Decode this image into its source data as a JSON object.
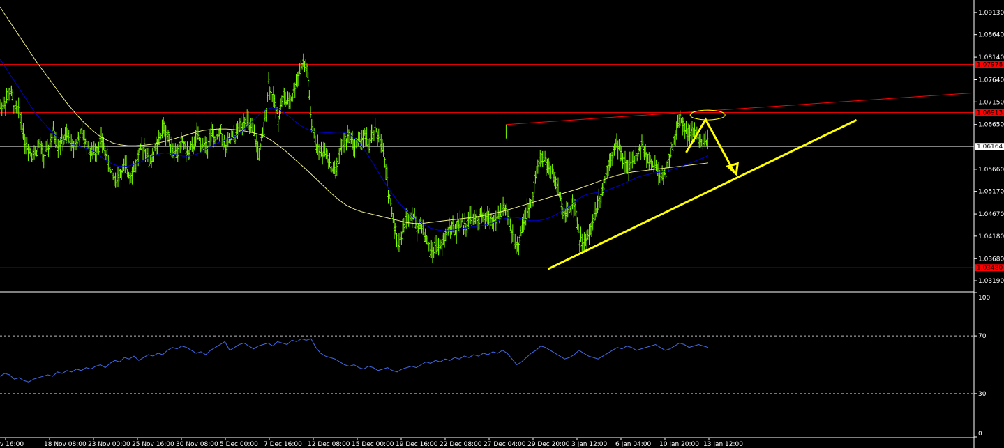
{
  "chart_data": [
    {
      "type": "candlestick",
      "panel": "main",
      "instrument_type": "bar-chart",
      "colors": {
        "background": "#000000",
        "bars": "#7CFC00",
        "axis_text": "#ffffff",
        "grid_line": "#ffffff",
        "support_resistance": "#ff0000",
        "annotation": "#ffff00",
        "fast_ma": "#0000cd",
        "slow_ma": "#eeee88"
      },
      "y_ticks": [
        "1.09130",
        "1.08640",
        "1.08140",
        "1.07640",
        "1.07150",
        "1.06650",
        "1.05660",
        "1.05170",
        "1.04670",
        "1.04180",
        "1.03680",
        "1.03190"
      ],
      "x_ticks": [
        "v 16:00",
        "18 Nov 08:00",
        "23 Nov 00:00",
        "25 Nov 16:00",
        "30 Nov 08:00",
        "5 Dec 00:00",
        "7 Dec 16:00",
        "12 Dec 08:00",
        "15 Dec 00:00",
        "19 Dec 16:00",
        "22 Dec 08:00",
        "27 Dec 04:00",
        "29 Dec 20:00",
        "3 Jan 12:00",
        "6 Jan 04:00",
        "10 Jan 20:00",
        "13 Jan 12:00"
      ],
      "ylim": [
        1.0299,
        1.0936
      ],
      "current_price": "1.06164",
      "horizontal_levels": [
        {
          "label": "1.07978",
          "value": 1.07978,
          "color": "#ff0000"
        },
        {
          "label": "1.06913",
          "value": 1.06913,
          "color": "#ff0000"
        },
        {
          "label": "1.03480",
          "value": 1.0348,
          "color": "#ff0000"
        }
      ],
      "price_path": [
        1.0705,
        1.0715,
        1.074,
        1.07,
        1.069,
        1.063,
        1.061,
        1.06,
        1.062,
        1.0595,
        1.061,
        1.065,
        1.062,
        1.063,
        1.064,
        1.0615,
        1.063,
        1.0645,
        1.062,
        1.06,
        1.061,
        1.063,
        1.0605,
        1.056,
        1.054,
        1.056,
        1.057,
        1.0555,
        1.057,
        1.06,
        1.062,
        1.058,
        1.06,
        1.0625,
        1.066,
        1.064,
        1.061,
        1.06,
        1.063,
        1.06,
        1.061,
        1.064,
        1.062,
        1.0615,
        1.0645,
        1.063,
        1.065,
        1.061,
        1.063,
        1.064,
        1.066,
        1.068,
        1.066,
        1.064,
        1.06,
        1.065,
        1.076,
        1.072,
        1.068,
        1.073,
        1.071,
        1.073,
        1.077,
        1.08,
        1.079,
        1.066,
        1.062,
        1.06,
        1.061,
        1.057,
        1.056,
        1.061,
        1.063,
        1.064,
        1.0615,
        1.063,
        1.064,
        1.062,
        1.065,
        1.064,
        1.06,
        1.052,
        1.046,
        1.04,
        1.043,
        1.046,
        1.047,
        1.044,
        1.044,
        1.041,
        1.038,
        1.04,
        1.039,
        1.042,
        1.044,
        1.043,
        1.045,
        1.044,
        1.046,
        1.045,
        1.046,
        1.0455,
        1.046,
        1.045,
        1.046,
        1.048,
        1.046,
        1.042,
        1.039,
        1.044,
        1.047,
        1.05,
        1.056,
        1.06,
        1.058,
        1.056,
        1.054,
        1.05,
        1.047,
        1.048,
        1.049,
        1.041,
        1.04,
        1.042,
        1.046,
        1.05,
        1.053,
        1.058,
        1.061,
        1.062,
        1.059,
        1.057,
        1.058,
        1.06,
        1.062,
        1.059,
        1.058,
        1.057,
        1.055,
        1.056,
        1.06,
        1.064,
        1.068,
        1.066,
        1.064,
        1.065,
        1.063,
        1.062,
        1.063
      ],
      "fast_ma": [
        1.081,
        1.079,
        1.077,
        1.075,
        1.073,
        1.071,
        1.069,
        1.0675,
        1.066,
        1.0645,
        1.0635,
        1.0628,
        1.0622,
        1.0618,
        1.0614,
        1.061,
        1.0605,
        1.0595,
        1.0585,
        1.0578,
        1.0573,
        1.0572,
        1.0574,
        1.0578,
        1.0583,
        1.059,
        1.0596,
        1.06,
        1.0602,
        1.06,
        1.0598,
        1.0595,
        1.0595,
        1.0598,
        1.0603,
        1.061,
        1.0618,
        1.0625,
        1.063,
        1.0635,
        1.064,
        1.065,
        1.0662,
        1.0675,
        1.0688,
        1.0698,
        1.0702,
        1.07,
        1.0693,
        1.0683,
        1.0672,
        1.0662,
        1.0655,
        1.065,
        1.0648,
        1.0647,
        1.0647,
        1.0648,
        1.0648,
        1.0645,
        1.0636,
        1.0622,
        1.0604,
        1.0584,
        1.0562,
        1.054,
        1.052,
        1.0502,
        1.0486,
        1.0472,
        1.046,
        1.045,
        1.0442,
        1.0436,
        1.0432,
        1.043,
        1.043,
        1.0432,
        1.0434,
        1.0436,
        1.0438,
        1.044,
        1.0442,
        1.0445,
        1.045,
        1.0455,
        1.0458,
        1.046,
        1.0458,
        1.0454,
        1.0452,
        1.0452,
        1.0454,
        1.0458,
        1.0464,
        1.0472,
        1.048,
        1.049,
        1.05,
        1.0508,
        1.0512,
        1.0514,
        1.0516,
        1.052,
        1.0525,
        1.053,
        1.0536,
        1.0542,
        1.0548,
        1.0552,
        1.0555,
        1.0558,
        1.056,
        1.0562,
        1.0566,
        1.057,
        1.0575,
        1.058,
        1.0585,
        1.059,
        1.0596
      ],
      "slow_ma": [
        1.0925,
        1.09,
        1.0875,
        1.085,
        1.0825,
        1.08,
        1.0778,
        1.0755,
        1.0732,
        1.071,
        1.069,
        1.0672,
        1.0656,
        1.0642,
        1.0632,
        1.0624,
        1.062,
        1.0618,
        1.0618,
        1.0619,
        1.0621,
        1.0624,
        1.0628,
        1.0633,
        1.0638,
        1.0643,
        1.0648,
        1.0652,
        1.0654,
        1.0655,
        1.0655,
        1.0654,
        1.0652,
        1.0649,
        1.0645,
        1.064,
        1.063,
        1.0618,
        1.0605,
        1.059,
        1.0575,
        1.056,
        1.0544,
        1.0528,
        1.0512,
        1.0498,
        1.0486,
        1.0478,
        1.0472,
        1.0468,
        1.0464,
        1.046,
        1.0456,
        1.0452,
        1.0448,
        1.0446,
        1.0446,
        1.0448,
        1.045,
        1.0452,
        1.0454,
        1.0456,
        1.0458,
        1.046,
        1.0463,
        1.0466,
        1.047,
        1.0474,
        1.0479,
        1.0484,
        1.0489,
        1.0494,
        1.0499,
        1.0504,
        1.0509,
        1.0514,
        1.0519,
        1.0524,
        1.053,
        1.0536,
        1.0542,
        1.0548,
        1.0553,
        1.0557,
        1.056,
        1.0562,
        1.0564,
        1.0566,
        1.0568,
        1.057,
        1.0572,
        1.0574,
        1.0576,
        1.0578,
        1.058
      ],
      "annotations": [
        {
          "kind": "resistance-trendline",
          "color": "#ff0000",
          "from": {
            "x_index": 0.52,
            "price": 1.0665
          },
          "to": {
            "x_index": 1.0,
            "price": 1.0735
          }
        },
        {
          "kind": "support-trendline",
          "color": "#ffff00",
          "from": {
            "x_index": 0.563,
            "price": 1.0345
          },
          "to": {
            "x_index": 0.88,
            "price": 1.0675
          }
        },
        {
          "kind": "target-ellipse",
          "color": "#ffff00",
          "center": {
            "x_index": 0.727,
            "price": 1.0686
          }
        },
        {
          "kind": "forecast-arrow",
          "color": "#ffff00",
          "points": [
            {
              "x_index": 0.705,
              "price": 1.0603
            },
            {
              "x_index": 0.725,
              "price": 1.0676
            },
            {
              "x_index": 0.755,
              "price": 1.0557
            }
          ]
        }
      ]
    },
    {
      "type": "line",
      "panel": "oscillator",
      "color": "#4169e1",
      "ylim": [
        0,
        100
      ],
      "y_ticks": [
        "100",
        "70",
        "30",
        "0"
      ],
      "levels": [
        70,
        30
      ],
      "values": [
        42,
        44,
        43,
        40,
        41,
        39,
        38,
        40,
        41,
        42,
        43,
        42,
        45,
        44,
        46,
        45,
        47,
        46,
        48,
        47,
        49,
        50,
        48,
        51,
        53,
        52,
        55,
        54,
        56,
        53,
        55,
        57,
        56,
        58,
        57,
        60,
        62,
        61,
        63,
        62,
        60,
        58,
        59,
        57,
        60,
        62,
        64,
        66,
        60,
        62,
        64,
        65,
        63,
        61,
        63,
        64,
        65,
        63,
        66,
        65,
        64,
        67,
        66,
        68,
        67,
        68,
        62,
        58,
        56,
        55,
        54,
        52,
        50,
        49,
        50,
        48,
        47,
        49,
        48,
        46,
        47,
        48,
        46,
        45,
        47,
        48,
        49,
        48,
        50,
        52,
        51,
        53,
        52,
        54,
        53,
        55,
        54,
        56,
        55,
        57,
        56,
        58,
        57,
        59,
        58,
        60,
        58,
        54,
        50,
        52,
        55,
        58,
        60,
        63,
        62,
        60,
        58,
        56,
        54,
        55,
        57,
        60,
        58,
        56,
        55,
        54,
        56,
        58,
        60,
        62,
        61,
        63,
        62,
        60,
        61,
        62,
        63,
        64,
        62,
        60,
        61,
        63,
        65,
        64,
        62,
        63,
        64,
        63,
        62
      ]
    }
  ]
}
